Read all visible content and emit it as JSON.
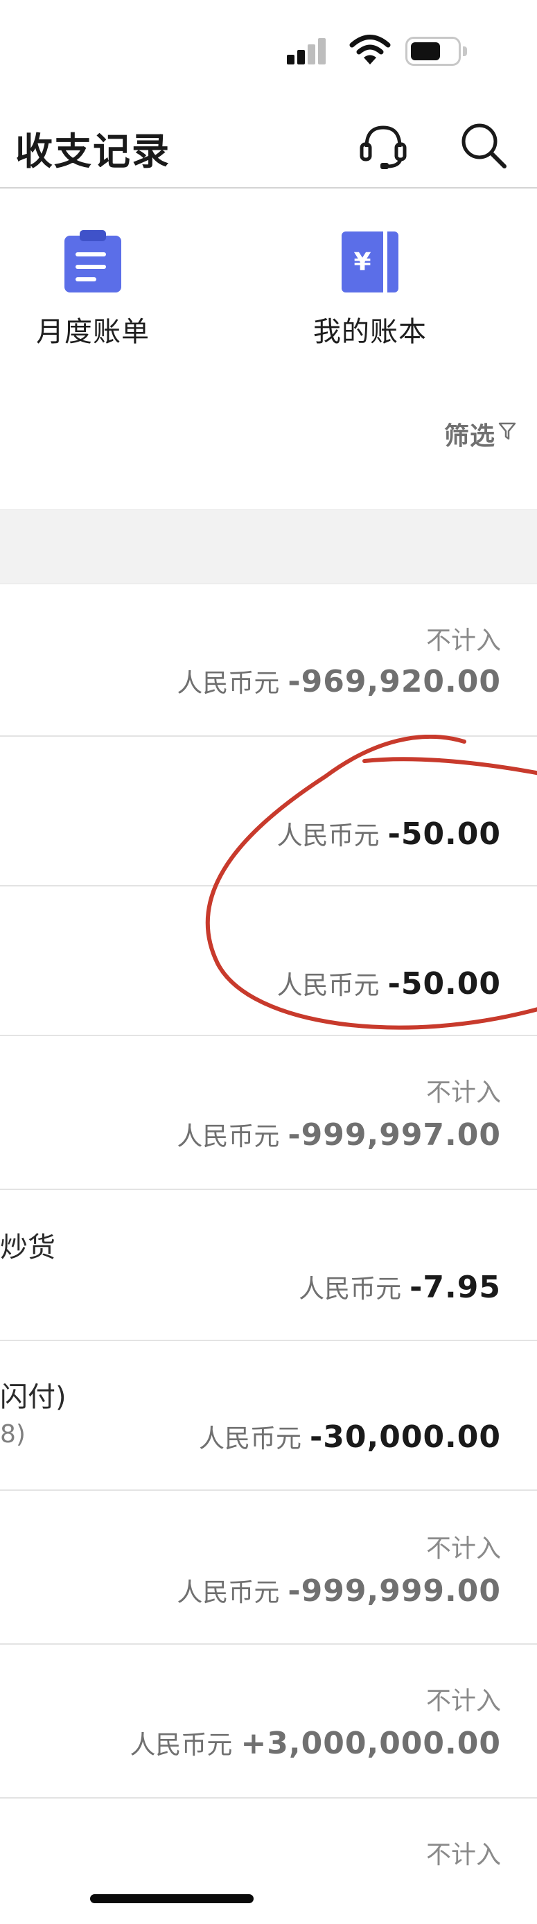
{
  "header": {
    "title": "收支记录",
    "support_icon": "headset-icon",
    "search_icon": "search-icon"
  },
  "quick_actions": [
    {
      "label": "月度账单",
      "icon": "clipboard-icon",
      "color": "#5b6ee8"
    },
    {
      "label": "我的账本",
      "icon": "ledger-yuan-icon",
      "color": "#5b6ee8"
    }
  ],
  "filter": {
    "label": "筛选"
  },
  "records": [
    {
      "left": "",
      "left_sub": "",
      "status": "不计入",
      "currency": "人民币元",
      "amount": "-969,920.00",
      "style": "gray"
    },
    {
      "left": "",
      "left_sub": "",
      "status": "",
      "currency": "人民币元",
      "amount": "-50.00",
      "style": "dark"
    },
    {
      "left": "",
      "left_sub": "",
      "status": "",
      "currency": "人民币元",
      "amount": "-50.00",
      "style": "dark"
    },
    {
      "left": "",
      "left_sub": "",
      "status": "不计入",
      "currency": "人民币元",
      "amount": "-999,997.00",
      "style": "gray"
    },
    {
      "left": "炒货",
      "left_sub": "",
      "status": "",
      "currency": "人民币元",
      "amount": "-7.95",
      "style": "dark"
    },
    {
      "left": "闪付)",
      "left_sub": "8)",
      "status": "",
      "currency": "人民币元",
      "amount": "-30,000.00",
      "style": "dark"
    },
    {
      "left": "",
      "left_sub": "",
      "status": "不计入",
      "currency": "人民币元",
      "amount": "-999,999.00",
      "style": "gray"
    },
    {
      "left": "",
      "left_sub": "",
      "status": "不计入",
      "currency": "人民币元",
      "amount": "+3,000,000.00",
      "style": "gray"
    },
    {
      "left": "",
      "left_sub": "",
      "status": "不计入",
      "currency": "",
      "amount": "",
      "style": "gray"
    }
  ],
  "colors": {
    "accent": "#5b6ee8",
    "annotation": "#c83a2c",
    "divider": "#e3e3e3"
  }
}
